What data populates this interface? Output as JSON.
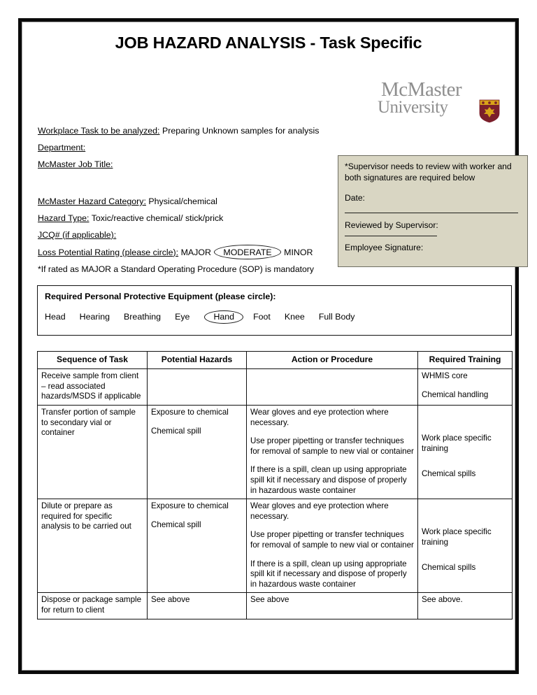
{
  "document": {
    "title": "JOB HAZARD ANALYSIS - Task Specific"
  },
  "logo": {
    "line1": "McMaster",
    "line2": "University",
    "crest_name": "mcmaster-crest",
    "text_color": "#8e8e8e",
    "crest_maroon": "#7b1f2b",
    "crest_gold": "#d9a419"
  },
  "form": {
    "workplace_task_label": "Workplace Task to be analyzed:",
    "workplace_task_value": "Preparing Unknown samples for analysis",
    "department_label": "Department:",
    "department_value": "",
    "job_title_label": "McMaster Job Title:",
    "job_title_value": "",
    "hazard_category_label": "McMaster Hazard Category:",
    "hazard_category_value": "Physical/chemical",
    "hazard_type_label": "Hazard Type:",
    "hazard_type_value": "Toxic/reactive chemical/ stick/prick",
    "jcq_label": "JCQ# (if applicable):",
    "jcq_value": "",
    "loss_potential_label": "Loss Potential Rating (please circle):",
    "loss_options": [
      "MAJOR",
      "MODERATE",
      "MINOR"
    ],
    "loss_selected": "MODERATE",
    "sop_note": "*If rated as MAJOR a Standard Operating Procedure (SOP) is mandatory"
  },
  "supervisor_box": {
    "background": "#d9d6c3",
    "note": "*Supervisor needs to review with worker and both signatures are required below",
    "date_label": "Date:",
    "reviewed_label": "Reviewed by Supervisor:",
    "employee_signature_label": "Employee Signature:"
  },
  "ppe": {
    "title": "Required Personal Protective Equipment (please circle):",
    "options": [
      "Head",
      "Hearing",
      "Breathing",
      "Eye",
      "Hand",
      "Foot",
      "Knee",
      "Full Body"
    ],
    "selected": "Hand"
  },
  "table": {
    "headers": [
      "Sequence of Task",
      "Potential Hazards",
      "Action or Procedure",
      "Required Training"
    ],
    "rows": [
      {
        "task": "Receive sample from client – read associated hazards/MSDS if applicable",
        "hazards": [],
        "actions": [],
        "training": [
          "WHMIS core",
          "Chemical handling"
        ]
      },
      {
        "task": "Transfer portion of sample to secondary vial or container",
        "hazards": [
          "Exposure to chemical",
          "Chemical spill"
        ],
        "actions": [
          "Wear gloves and eye protection where necessary.",
          "Use proper pipetting or transfer techniques for removal of sample to new vial or container",
          "If there is a spill, clean up using appropriate spill kit if necessary and dispose of properly in hazardous waste container"
        ],
        "training": [
          "Work place specific training",
          "Chemical spills"
        ]
      },
      {
        "task": "Dilute or prepare as required for specific analysis to be carried out",
        "hazards": [
          "Exposure to chemical",
          "Chemical spill"
        ],
        "actions": [
          "Wear gloves and eye protection where necessary.",
          "Use proper pipetting or transfer techniques for removal of sample to new vial or container",
          "If there is a spill, clean up using appropriate spill kit if necessary and dispose of properly in hazardous waste container"
        ],
        "training": [
          "Work place specific training",
          "Chemical spills"
        ]
      },
      {
        "task": "Dispose or package sample for return to client",
        "hazards": [
          "See above"
        ],
        "actions": [
          "See above"
        ],
        "training": [
          "See above."
        ]
      }
    ]
  }
}
